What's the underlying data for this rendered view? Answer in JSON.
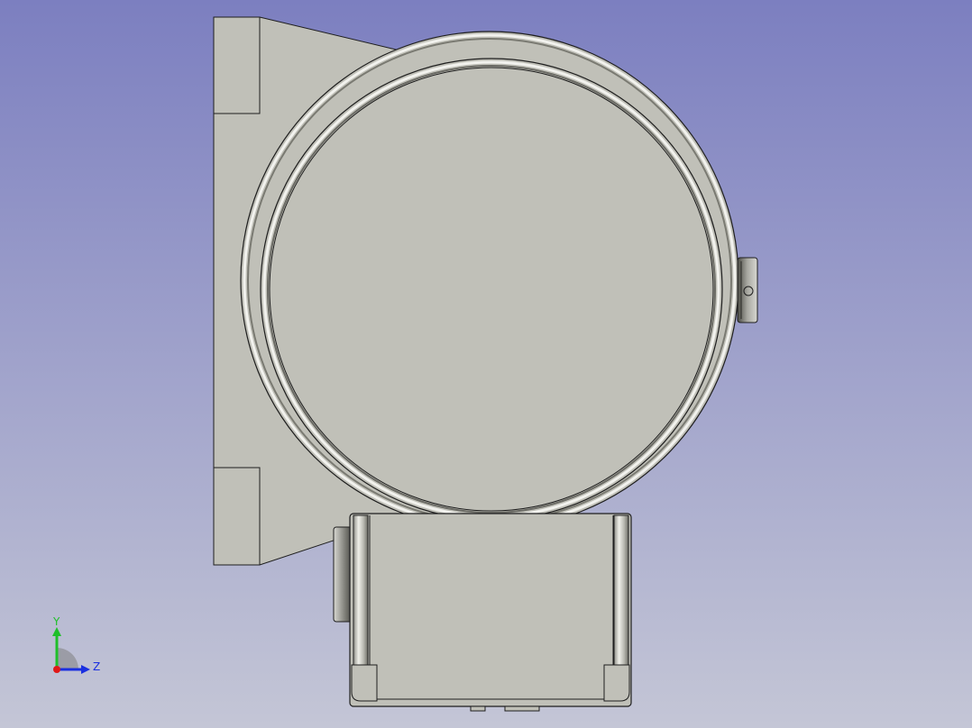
{
  "viewport": {
    "background_top": "#7c7fc0",
    "background_bottom": "#c4c6d6"
  },
  "model": {
    "body_color": "#c0c0b8",
    "edge_color": "#1e1e1e",
    "highlight_color": "#f2f2ee",
    "shadow_color": "#6a6a64"
  },
  "axis_triad": {
    "y_label": "Y",
    "z_label": "Z",
    "y_color": "#1fbf2a",
    "z_color": "#1a2fe0",
    "x_color": "#e01818"
  }
}
